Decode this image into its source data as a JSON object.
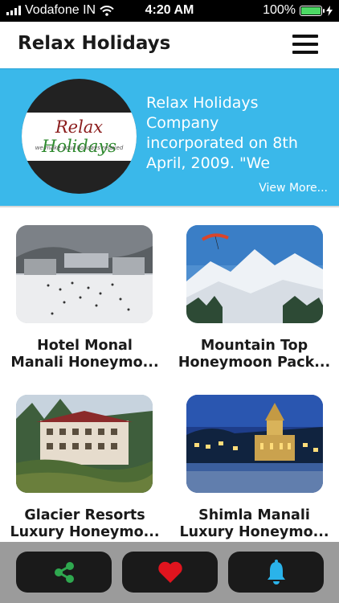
{
  "status_bar": {
    "carrier": "Vodafone IN",
    "time": "4:20 AM",
    "battery": "100%",
    "battery_level": 1.0
  },
  "header": {
    "title": "Relax Holidays",
    "menu_icon": "hamburger-menu-icon"
  },
  "banner": {
    "logo_brand_a": "Relax",
    "logo_brand_b": "Holidays",
    "logo_tagline": "we make your holidays relaxed",
    "description_lines": [
      "Relax Holidays",
      "Company",
      "incorporated on 8th",
      "April, 2009. \"We"
    ],
    "view_more": "View More..."
  },
  "packages": [
    {
      "line1": "Hotel Monal",
      "line2": "Manali Honeymo...",
      "image": "snowy-town-photo"
    },
    {
      "line1": "Mountain Top",
      "line2": "Honeymoon Pack...",
      "image": "snow-mountain-paraglider-photo"
    },
    {
      "line1": "Glacier Resorts",
      "line2": "Luxury Honeymo...",
      "image": "resort-building-photo"
    },
    {
      "line1": "Shimla Manali",
      "line2": "Luxury Honeymo...",
      "image": "church-night-photo"
    }
  ],
  "bottom_nav": [
    {
      "icon": "share-icon",
      "color": "#2fa84f"
    },
    {
      "icon": "heart-icon",
      "color": "#e0141e"
    },
    {
      "icon": "bell-icon",
      "color": "#2ab3ea"
    }
  ],
  "colors": {
    "banner_bg": "#3ab8ea",
    "bottom_bar_bg": "#9b9b9b",
    "button_bg": "#1a1a1a"
  }
}
